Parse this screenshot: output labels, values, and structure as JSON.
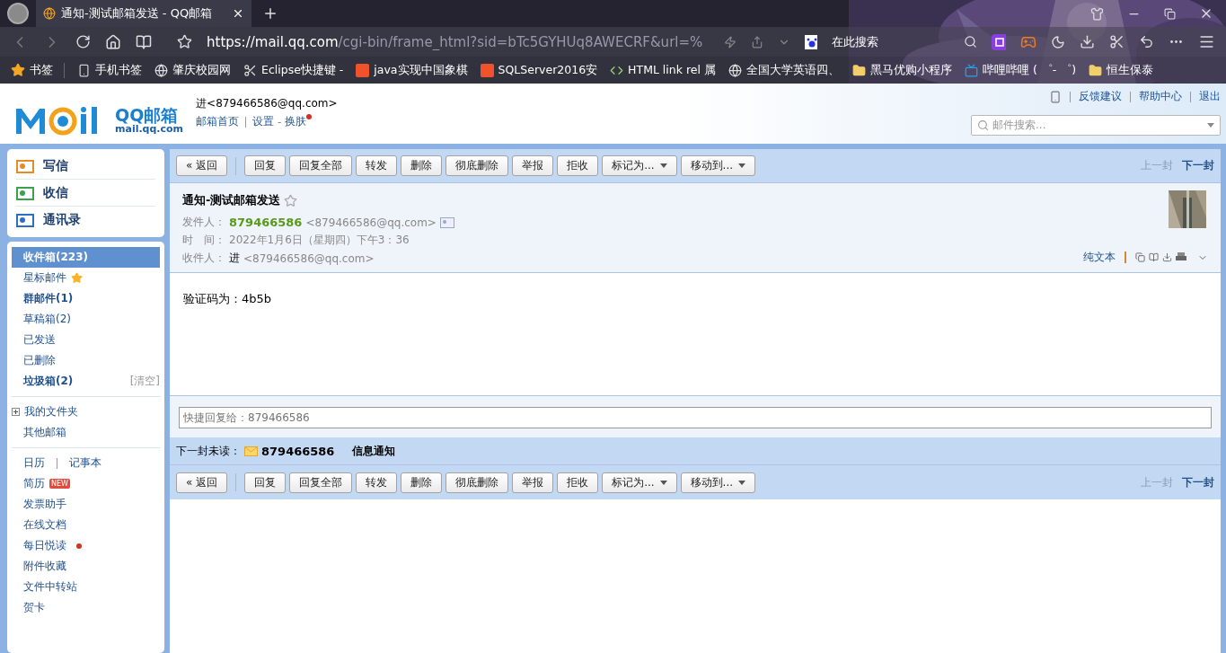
{
  "browser": {
    "tab": {
      "title": "通知-测试邮箱发送 - QQ邮箱",
      "selected": true
    },
    "address": {
      "host": "https://mail.qq.com",
      "path": "/cgi-bin/frame_html?sid=bTc5GYHUq8AWECRF&url=%"
    },
    "search": {
      "placeholder": "在此搜索"
    },
    "bookmarks": [
      {
        "kind": "star",
        "label": "书签"
      },
      {
        "kind": "phone",
        "label": "手机书签"
      },
      {
        "kind": "globe",
        "label": "肇庆校园网"
      },
      {
        "kind": "eclipse",
        "label": "Eclipse快捷键 -"
      },
      {
        "kind": "csdn",
        "label": "java实现中国象棋"
      },
      {
        "kind": "csdn",
        "label": "SQLServer2016安"
      },
      {
        "kind": "code",
        "label": "HTML link rel 属"
      },
      {
        "kind": "globe",
        "label": "全国大学英语四、"
      },
      {
        "kind": "folder",
        "label": "黑马优购小程序"
      },
      {
        "kind": "tv",
        "label": "哔哩哔哩 ( ゜- ゜)"
      },
      {
        "kind": "folder",
        "label": "恒生保泰"
      }
    ]
  },
  "mail_header": {
    "logo": "QQ邮箱",
    "logo_domain": "mail.qq.com",
    "account": "进<879466586@qq.com>",
    "links": [
      {
        "label": "邮箱首页",
        "dot": false
      },
      {
        "label": "设置",
        "dot": false
      },
      {
        "label": "换肤",
        "dot": true,
        "separator": "-"
      }
    ],
    "top_links": [
      "反馈建议",
      "帮助中心",
      "退出"
    ],
    "search": {
      "placeholder": "邮件搜索..."
    }
  },
  "sidebar": {
    "actions": [
      {
        "kind": "write",
        "label": "写信"
      },
      {
        "kind": "receive",
        "label": "收信"
      },
      {
        "kind": "contacts",
        "label": "通讯录"
      }
    ],
    "groups": [
      [
        {
          "label": "收件箱(223)",
          "selected": true,
          "bold": true
        },
        {
          "label": "星标邮件",
          "selected": false,
          "bold": false,
          "star": true
        },
        {
          "label": "群邮件(1)",
          "selected": false,
          "bold": true
        },
        {
          "label": "草稿箱(2)",
          "selected": false,
          "bold": false
        },
        {
          "label": "已发送",
          "selected": false,
          "bold": false
        },
        {
          "label": "已删除",
          "selected": false,
          "bold": false
        },
        {
          "label": "垃圾箱(2)",
          "selected": false,
          "bold": true,
          "action": "[清空]"
        }
      ],
      [
        {
          "label": "我的文件夹",
          "selected": false,
          "bold": false,
          "expanded": false
        },
        {
          "label": "其他邮箱",
          "selected": false,
          "bold": false
        }
      ],
      [
        {
          "label": "日历",
          "selected": false,
          "bold": false,
          "pair": "记事本"
        },
        {
          "label": "简历",
          "selected": false,
          "bold": false,
          "badge": "NEW"
        },
        {
          "label": "发票助手",
          "selected": false,
          "bold": false
        },
        {
          "label": "在线文档",
          "selected": false,
          "bold": false
        },
        {
          "label": "每日悦读",
          "selected": false,
          "bold": false,
          "dot": true
        },
        {
          "label": "附件收藏",
          "selected": false,
          "bold": false
        },
        {
          "label": "文件中转站",
          "selected": false,
          "bold": false
        },
        {
          "label": "贺卡",
          "selected": false,
          "bold": false
        }
      ]
    ]
  },
  "toolbar": {
    "back": "« 返回",
    "buttons": [
      {
        "kind": "button",
        "label": "回复"
      },
      {
        "kind": "button",
        "label": "回复全部"
      },
      {
        "kind": "button",
        "label": "转发"
      },
      {
        "kind": "button",
        "label": "删除"
      },
      {
        "kind": "button",
        "label": "彻底删除"
      },
      {
        "kind": "button",
        "label": "举报"
      },
      {
        "kind": "button",
        "label": "拒收"
      },
      {
        "kind": "dropdown",
        "label": "标记为..."
      },
      {
        "kind": "dropdown",
        "label": "移动到..."
      }
    ],
    "nav": [
      {
        "label": "上一封",
        "disabled": true
      },
      {
        "label": "下一封",
        "disabled": false
      }
    ]
  },
  "mail": {
    "subject": "通知-测试邮箱发送",
    "starred": false,
    "from": {
      "label": "发件人：",
      "name": "879466586",
      "address": "<879466586@qq.com>"
    },
    "time": {
      "label": "时　间：",
      "value": "2022年1月6日（星期四）下午3：36"
    },
    "to": {
      "label": "收件人：",
      "name": "进",
      "address": "<879466586@qq.com>"
    },
    "plain_text": "纯文本",
    "body": "验证码为：4b5b"
  },
  "quick_reply": {
    "placeholder": "快捷回复给：879466586"
  },
  "next_unread": {
    "label": "下一封未读：",
    "sender": "879466586",
    "subject": "信息通知"
  },
  "bottom_toolbar": {
    "back": "« 返回",
    "buttons": [
      {
        "kind": "button",
        "label": "回复"
      },
      {
        "kind": "button",
        "label": "回复全部"
      },
      {
        "kind": "button",
        "label": "转发"
      },
      {
        "kind": "button",
        "label": "删除"
      },
      {
        "kind": "button",
        "label": "彻底删除"
      },
      {
        "kind": "button",
        "label": "举报"
      },
      {
        "kind": "button",
        "label": "拒收"
      },
      {
        "kind": "dropdown",
        "label": "标记为..."
      },
      {
        "kind": "dropdown",
        "label": "移动到..."
      }
    ],
    "nav": [
      {
        "label": "上一封",
        "disabled": true
      },
      {
        "label": "下一封",
        "disabled": false
      }
    ]
  }
}
